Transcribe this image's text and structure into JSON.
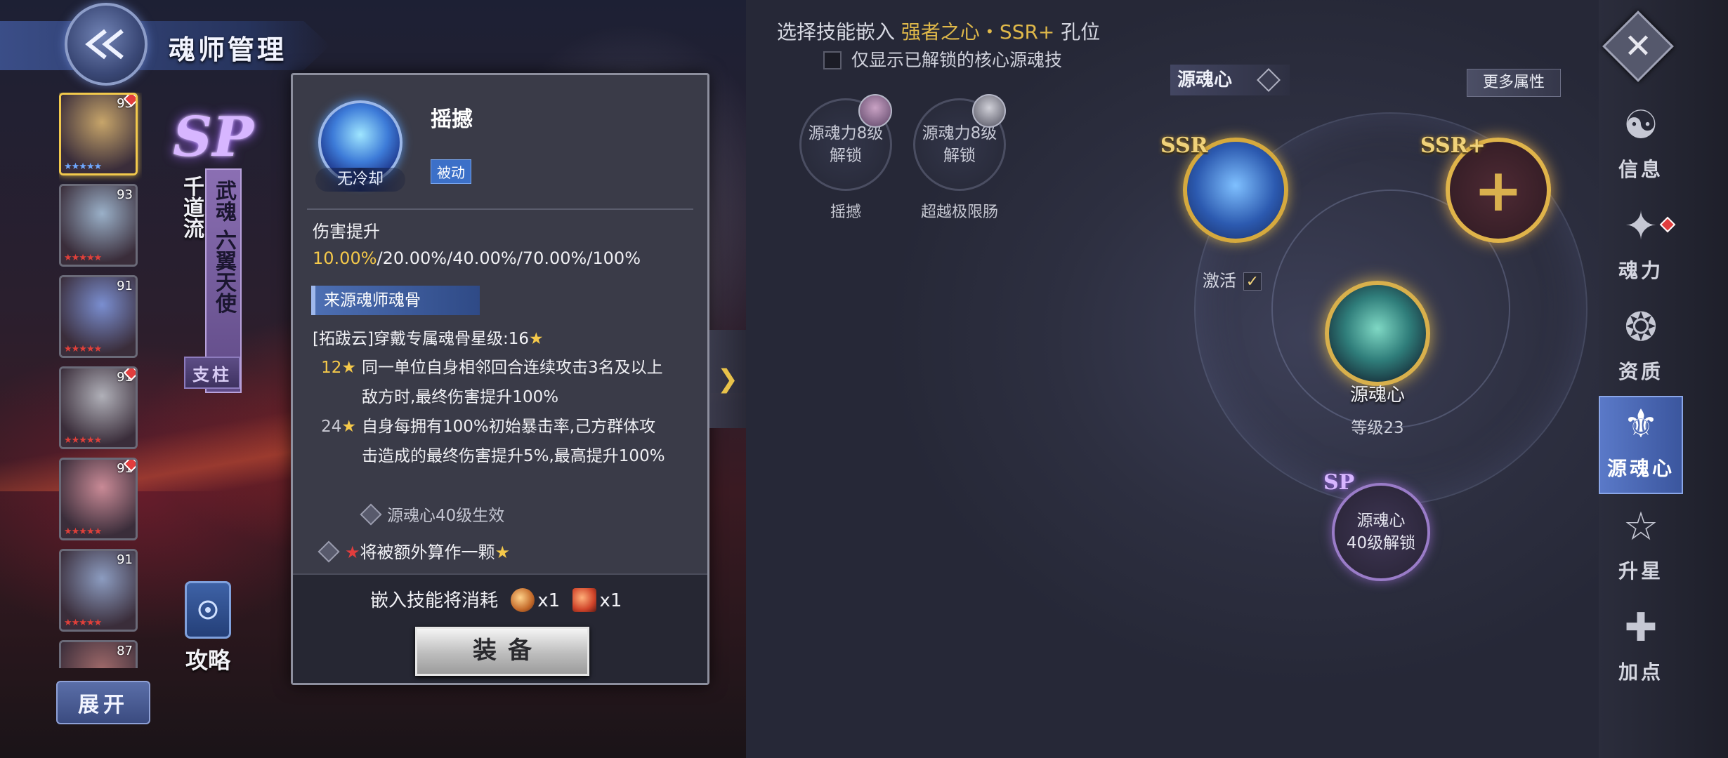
{
  "header": {
    "title": "魂师管理",
    "back_icon": "double-chevron-left-icon"
  },
  "hero_list": {
    "heroes": [
      {
        "level": "93",
        "selected": true,
        "badge": true
      },
      {
        "level": "93",
        "selected": false,
        "badge": false
      },
      {
        "level": "91",
        "selected": false,
        "badge": false
      },
      {
        "level": "91",
        "selected": false,
        "badge": true
      },
      {
        "level": "91",
        "selected": false,
        "badge": true
      },
      {
        "level": "91",
        "selected": false,
        "badge": false
      },
      {
        "level": "87",
        "selected": false,
        "badge": false
      }
    ],
    "expand_label": "展开"
  },
  "hero_info": {
    "sp_badge": "SP",
    "sect": "千道流",
    "spirit": "武魂 六翼天使",
    "role": "支柱",
    "strategy_label": "攻略"
  },
  "tooltip": {
    "skill_name": "摇撼",
    "cooldown": "无冷却",
    "type_tag": "被动",
    "effect_prefix": "伤害提升",
    "effect_highlight": "10.00%",
    "effect_rest": "/20.00%/40.00%/70.00%/100%",
    "source_label": "来源魂师魂骨",
    "bone_info": "[拓跋云]穿戴专属魂骨星级:16",
    "tiers": [
      {
        "req": "12",
        "text": "同一单位自身相邻回合连续攻击3名及以上敌方时,最终伤害提升100%"
      },
      {
        "req": "24",
        "text": "自身每拥有100%初始暴击率,己方群体攻击造成的最终伤害提升5%,最高提升100%"
      }
    ],
    "condition": "源魂心40级生效",
    "note": "将被额外算作一颗",
    "cost_label": "嵌入技能将消耗",
    "cost_items": [
      {
        "icon": "orb-item-icon",
        "qty": "x1"
      },
      {
        "icon": "crystal-item-icon",
        "qty": "x1"
      }
    ],
    "equip_label": "装备"
  },
  "right_panel": {
    "heading_prefix": "选择技能嵌入",
    "heading_target": "强者之心・SSR+",
    "heading_suffix": "孔位",
    "filter_label": "仅显示已解锁的核心源魂技",
    "skill_slots": [
      {
        "line1": "源魂力8级",
        "line2": "解锁",
        "name": "摇撼"
      },
      {
        "line1": "源魂力8级",
        "line2": "解锁",
        "name": "超越极限肠"
      }
    ],
    "core_label": "源魂心",
    "more_attr_label": "更多属性",
    "ssr_tag": "SSR",
    "ssrplus_tag": "SSR+",
    "activate_label": "激活",
    "core_name": "源魂心",
    "core_level": "等级23",
    "sp_tag": "SP",
    "sp_slot_line1": "源魂心",
    "sp_slot_line2": "40级解锁"
  },
  "nav": {
    "close_icon": "close-icon",
    "items": [
      {
        "label": "信息",
        "glyph": "☯",
        "active": false,
        "dot": false
      },
      {
        "label": "魂力",
        "glyph": "✦",
        "active": false,
        "dot": true
      },
      {
        "label": "资质",
        "glyph": "❂",
        "active": false,
        "dot": false
      },
      {
        "label": "源魂心",
        "glyph": "⚜",
        "active": true,
        "dot": false
      },
      {
        "label": "升星",
        "glyph": "☆",
        "active": false,
        "dot": false
      },
      {
        "label": "加点",
        "glyph": "✚",
        "active": false,
        "dot": false
      }
    ]
  },
  "colors": {
    "accent_gold": "#e0b94a",
    "highlight_yellow": "#f5c94a",
    "nav_active": "#5a79c8",
    "alert_red": "#e23d3d"
  }
}
